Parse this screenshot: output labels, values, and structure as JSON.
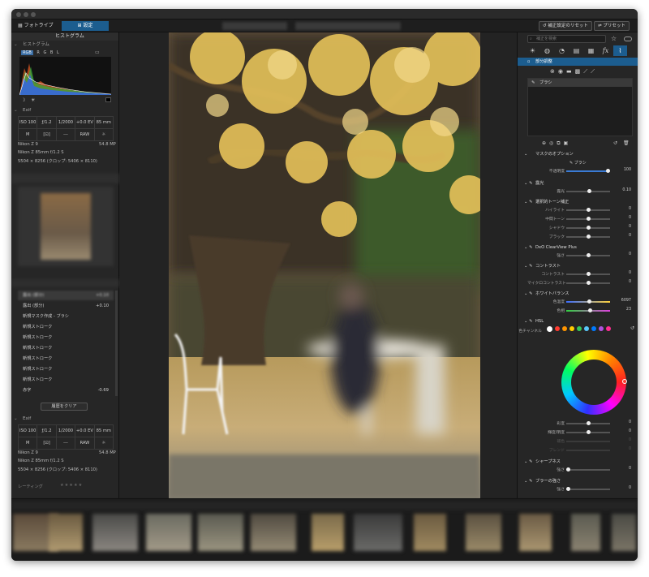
{
  "toolbar": {
    "library_tab": "フォトライブラリ",
    "edit_tab": "設定",
    "reset_button": "補正設定のリセット",
    "preset_button": "プリセット"
  },
  "left_panel": {
    "histogram_header": "ヒストグラム",
    "histogram_channels": [
      "RGB",
      "R",
      "G",
      "B",
      "L"
    ],
    "exif_header": "Exif",
    "exif_top": {
      "row1": [
        "ISO 100",
        "ƒ/1.2",
        "1/2000 s",
        "+0.0 EV",
        "85 mm"
      ],
      "row2": [
        "M",
        "[⊡]",
        "---",
        "RAW",
        "☼"
      ],
      "camera": "Nikon Z 9",
      "megapixels": "54.8 MP",
      "lens": "Nikon Z 85mm f/1.2 S",
      "dimensions": "5504 × 8256 (クロップ: 5406 × 8110)"
    },
    "history_items": [
      {
        "label": "露出 (部分)",
        "value": "+0.10"
      },
      {
        "label": "新規マスク作成 - ブラシ",
        "value": ""
      },
      {
        "label": "新規ストローク",
        "value": ""
      },
      {
        "label": "新規ストローク",
        "value": ""
      },
      {
        "label": "新規ストローク",
        "value": ""
      },
      {
        "label": "新規ストローク",
        "value": ""
      },
      {
        "label": "新規ストローク",
        "value": ""
      },
      {
        "label": "新規ストローク",
        "value": ""
      },
      {
        "label": "赤字",
        "value": "-0.69"
      }
    ],
    "clear_history_button": "履歴をクリア",
    "exif_bottom": {
      "row1": [
        "ISO 100",
        "ƒ/1.2",
        "1/2000 s",
        "+0.0 EV",
        "85 mm"
      ],
      "row2": [
        "M",
        "[⊡]",
        "---",
        "RAW",
        "☼"
      ],
      "camera": "Nikon Z 9",
      "megapixels": "54.8 MP",
      "lens": "Nikon Z 85mm f/1.2 S",
      "dimensions": "5504 × 8256 (クロップ: 5406 × 8110)"
    },
    "rating_label": "レーティング"
  },
  "right_panel": {
    "search_placeholder": "補正を検索",
    "local_adjust_header": "部分調整",
    "brush_item": "ブラシ",
    "mask_options_header": "マスクのオプション",
    "mask_brush_label": "ブラシ",
    "mask_opacity_label": "不透明度",
    "mask_opacity_value": "100",
    "exposure_header": "露光",
    "exposure_label": "露光",
    "exposure_value": "0.10",
    "tone_header": "選択的トーン補正",
    "tone_rows": [
      {
        "label": "ハイライト",
        "value": "0"
      },
      {
        "label": "中間トーン",
        "value": "0"
      },
      {
        "label": "シャドウ",
        "value": "0"
      },
      {
        "label": "ブラック",
        "value": "0"
      }
    ],
    "clearview_header": "DxO ClearView Plus",
    "clearview_label": "強さ",
    "clearview_value": "0",
    "contrast_header": "コントラスト",
    "contrast_rows": [
      {
        "label": "コントラスト",
        "value": "0"
      },
      {
        "label": "マイクロコントラスト",
        "value": "0"
      }
    ],
    "wb_header": "ホワイトバランス",
    "wb_rows": [
      {
        "label": "色温度",
        "value": "6097"
      },
      {
        "label": "色相",
        "value": "23"
      }
    ],
    "hsl_header": "HSL",
    "hsl_channel_label": "色チャンネル",
    "hsl_swatches": [
      "#ffffff",
      "#ff3b30",
      "#ff9500",
      "#ffcc00",
      "#34c759",
      "#5ac8fa",
      "#007aff",
      "#af52de",
      "#ff2d92"
    ],
    "hsl_rows": [
      {
        "label": "彩度",
        "value": "0"
      },
      {
        "label": "輝度/明度",
        "value": "0"
      },
      {
        "label": "補色",
        "value": "0"
      },
      {
        "label": "ブレンド",
        "value": "0"
      }
    ],
    "sharpen_header": "シャープネス",
    "sharpen_label": "強さ",
    "sharpen_value": "0",
    "blur_header": "ブラーの強さ",
    "blur_label": "強さ",
    "blur_value": "0"
  },
  "colors": {
    "accent": "#1c5d8f",
    "panel": "#262626"
  }
}
